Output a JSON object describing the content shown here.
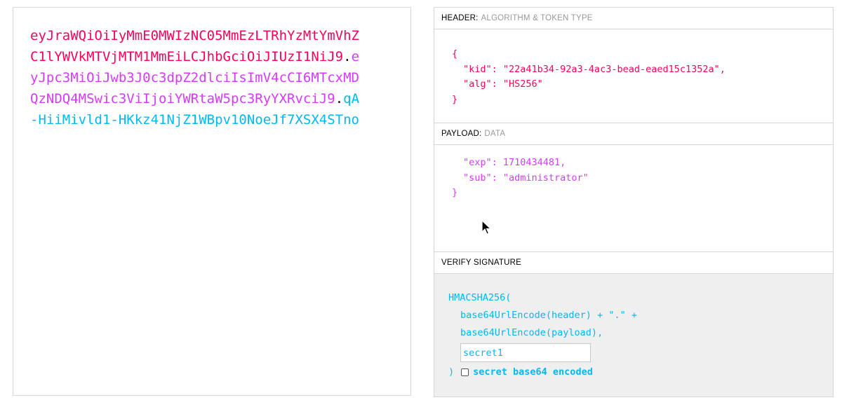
{
  "encoded": {
    "header": "eyJraWQiOiIyMmE0MWIzNC05MmEzLTRhYzMtYmVhZC1lYWVkMTVjMTM1MmEiLCJhbGciOiJIUzI1NiJ9",
    "dot1": ".",
    "payload": "eyJpc3MiOiJwb3J0c3dpZ2dlciIsImV4cCI6MTcxMDQzNDQ4MSwic3ViIjoiYWRtaW5pc3RyYXRvciJ9",
    "dot2": ".",
    "signature": "qA-HiiMivld1-HKkz41NjZ1WBpv10NoeJf7XSX4STno"
  },
  "header_section": {
    "title": "HEADER:",
    "subtitle": "ALGORITHM & TOKEN TYPE",
    "open": "{",
    "line1": "\"kid\": \"22a41b34-92a3-4ac3-bead-eaed15c1352a\",",
    "line2": "\"alg\": \"HS256\"",
    "close": "}"
  },
  "payload_section": {
    "title": "PAYLOAD:",
    "subtitle": "DATA",
    "line1": "\"exp\": 1710434481,",
    "line2": "\"sub\": \"administrator\"",
    "close": "}"
  },
  "verify_section": {
    "title": "VERIFY SIGNATURE",
    "fn": "HMACSHA256(",
    "arg1": "base64UrlEncode(header) + \".\" +",
    "arg2": "base64UrlEncode(payload),",
    "secret_value": "secret1",
    "close": ")",
    "checkbox_label": "secret base64 encoded"
  },
  "colors": {
    "header": "#fb015b",
    "payload": "#d63aff",
    "signature": "#00b9f1"
  },
  "icons": {
    "cursor": "mouse-pointer-icon"
  }
}
